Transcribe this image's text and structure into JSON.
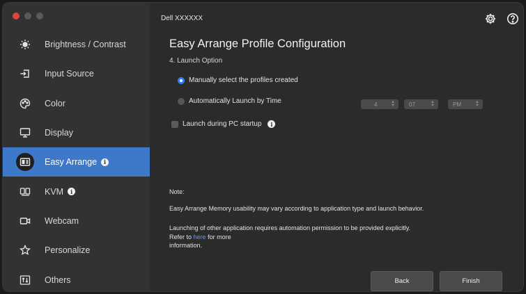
{
  "window": {
    "device_title": "Dell XXXXXX"
  },
  "sidebar": {
    "items": [
      {
        "label": "Brightness / Contrast",
        "icon": "brightness-icon",
        "info": false
      },
      {
        "label": "Input Source",
        "icon": "input-source-icon",
        "info": false
      },
      {
        "label": "Color",
        "icon": "color-palette-icon",
        "info": false
      },
      {
        "label": "Display",
        "icon": "display-monitor-icon",
        "info": false
      },
      {
        "label": "Easy Arrange",
        "icon": "easy-arrange-icon",
        "info": true,
        "active": true
      },
      {
        "label": "KVM",
        "icon": "kvm-icon",
        "info": true
      },
      {
        "label": "Webcam",
        "icon": "webcam-icon",
        "info": false
      },
      {
        "label": "Personalize",
        "icon": "star-icon",
        "info": false
      },
      {
        "label": "Others",
        "icon": "others-icon",
        "info": false
      }
    ],
    "info_glyph": "i"
  },
  "main": {
    "title": "Easy Arrange Profile Configuration",
    "section": "4. Launch Option",
    "option_manual": "Manually select the profiles created",
    "option_auto": "Automatically Launch by Time",
    "option_startup": "Launch during PC startup",
    "time": {
      "hour": "4",
      "minute": "07",
      "ampm": "PM"
    },
    "note_heading": "Note:",
    "note_line1": "Easy Arrange Memory usability may vary according to application type and launch behavior.",
    "note_line2": "Launching of other application requires automation permission to be provided explicitly.",
    "note_refer": "Refer to",
    "note_link": "here",
    "note_for_more": "for more",
    "note_information": "information.",
    "back_label": "Back",
    "finish_label": "Finish"
  },
  "colors": {
    "accent": "#3d78c9",
    "radio": "#2f7cf6",
    "link": "#5a9cf7"
  }
}
